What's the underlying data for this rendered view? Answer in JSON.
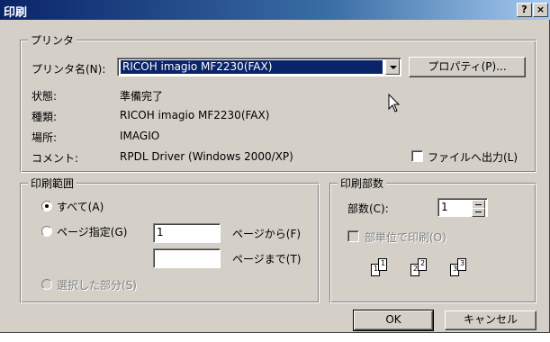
{
  "window": {
    "title": "印刷",
    "help_btn": "?",
    "close_btn": "×"
  },
  "printer": {
    "legend": "プリンタ",
    "name_label": "プリンタ名(N):",
    "name_value": "RICOH imagio MF2230(FAX)",
    "properties_btn": "プロパティ(P)...",
    "status_label": "状態:",
    "status_value": "準備完了",
    "type_label": "種類:",
    "type_value": "RICOH imagio MF2230(FAX)",
    "location_label": "場所:",
    "location_value": "IMAGIO",
    "comment_label": "コメント:",
    "comment_value": "RPDL Driver (Windows 2000/XP)",
    "print_to_file": "ファイルへ出力(L)",
    "print_to_file_checked": false
  },
  "range": {
    "legend": "印刷範囲",
    "all": "すべて(A)",
    "pages": "ページ指定(G)",
    "pages_from_value": "1",
    "pages_from_label": "ページから(F)",
    "pages_to_value": "",
    "pages_to_label": "ページまで(T)",
    "selection": "選択した部分(S)",
    "selected": "all"
  },
  "copies": {
    "legend": "印刷部数",
    "count_label": "部数(C):",
    "count_value": "1",
    "collate": "部単位で印刷(O)",
    "collate_checked": false,
    "collate_pages": [
      "1",
      "1",
      "2",
      "2",
      "3",
      "3"
    ]
  },
  "buttons": {
    "ok": "OK",
    "cancel": "キャンセル"
  }
}
